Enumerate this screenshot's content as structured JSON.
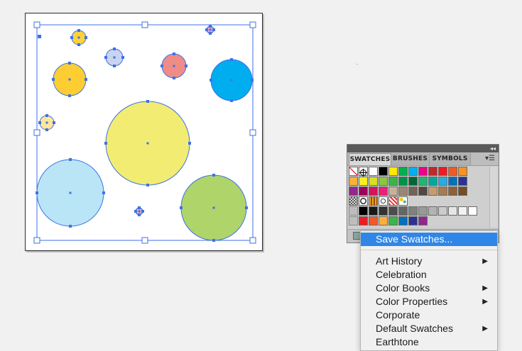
{
  "swatches_panel": {
    "tabs": [
      {
        "label": "SWATCHES",
        "active": true
      },
      {
        "label": "BRUSHES",
        "active": false
      },
      {
        "label": "SYMBOLS",
        "active": false
      }
    ],
    "collapse_icon": "double-chevron-icon",
    "menu_icon": "panel-menu-icon",
    "rows": [
      [
        "none",
        "registration",
        "#ffffff",
        "#000000",
        "#ffea00",
        "#00b050",
        "#00b0f0",
        "#ec008c",
        "#c1272d",
        "#ed1c24",
        "#f15a24",
        "#f7931e"
      ],
      [
        "#fbb03b",
        "#fcee21",
        "#d9e021",
        "#8cc63f",
        "#39b54a",
        "#009245",
        "#006837",
        "#22b573",
        "#00a99d",
        "#29abe2",
        "#0071bc",
        "#2e3192"
      ],
      [
        "#93278f",
        "#9e005d",
        "#d4145a",
        "#ed1e79",
        "#c7b299",
        "#998675",
        "#736357",
        "#534741",
        "#c69c6d",
        "#a67c52",
        "#8c6239",
        "#754c24"
      ],
      [
        "pattern-checker",
        "pattern-circle",
        "pattern-stripes",
        "pattern-ring",
        "pattern-dots",
        "pattern-confetti"
      ],
      [
        "#000000",
        "#1a1a1a",
        "#333333",
        "#4d4d4d",
        "#666666",
        "#808080",
        "#999999",
        "#b3b3b3",
        "#cccccc",
        "#e6e6e6",
        "#f2f2f2",
        "#ffffff"
      ],
      [
        "#ed1c24",
        "#f15a24",
        "#fbb03b",
        "#39b54a",
        "#0071bc",
        "#2e3192",
        "#93278f"
      ]
    ]
  },
  "flyout_menu": {
    "items": [
      {
        "label": "Save Swatches...",
        "highlighted": true,
        "submenu": false
      },
      {
        "label": "Art History",
        "submenu": true
      },
      {
        "label": "Celebration",
        "submenu": false
      },
      {
        "label": "Color Books",
        "submenu": true
      },
      {
        "label": "Color Properties",
        "submenu": true
      },
      {
        "label": "Corporate",
        "submenu": false
      },
      {
        "label": "Default Swatches",
        "submenu": true
      },
      {
        "label": "Earthtone",
        "submenu": false
      }
    ],
    "submenu_icon": "triangle-right-icon"
  },
  "artboard": {
    "selection_color": "#3d72e5",
    "circles": [
      {
        "fill": "#ffd23a",
        "role": "small-yellow"
      },
      {
        "fill": "#c9d4f0",
        "role": "lavender"
      },
      {
        "fill": "#ef8c88",
        "role": "coral"
      },
      {
        "fill": "#fdcd32",
        "role": "gold"
      },
      {
        "fill": "#00adef",
        "role": "cyan"
      },
      {
        "fill": "#ffe69a",
        "role": "tiny-cream"
      },
      {
        "fill": "#f2ec72",
        "role": "big-yellow"
      },
      {
        "fill": "#b9e5f7",
        "role": "light-blue"
      },
      {
        "fill": "#afd46a",
        "role": "green"
      },
      {
        "fill": "#f4a3b2",
        "role": "tiny-pink"
      },
      {
        "fill": "#f3a3c4",
        "role": "tiny-pink-2"
      }
    ]
  }
}
